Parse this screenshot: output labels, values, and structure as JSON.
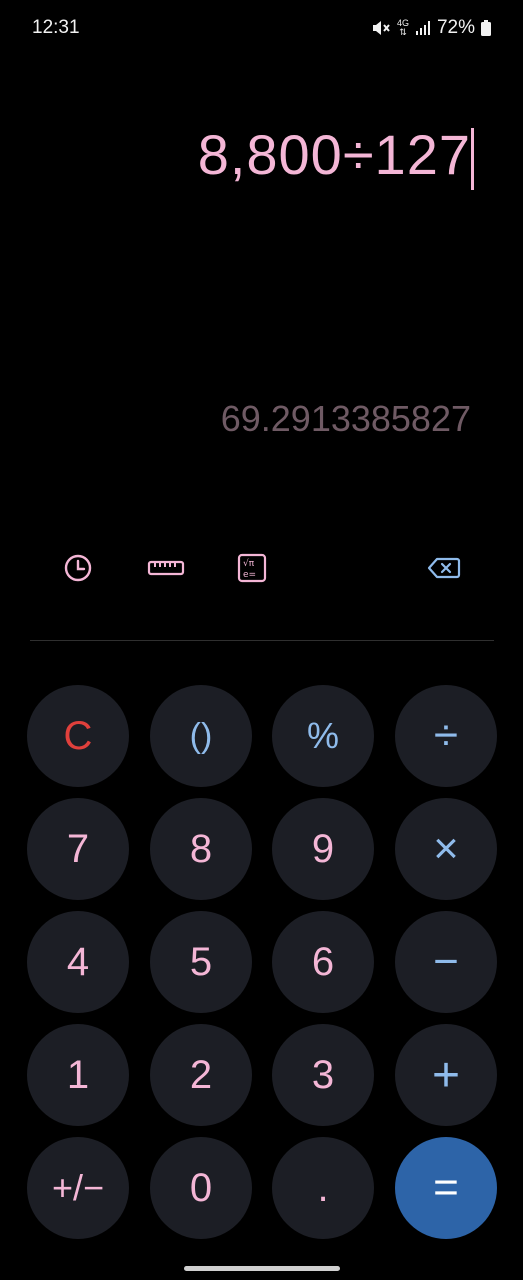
{
  "status_bar": {
    "time": "12:31",
    "network": "4G",
    "battery_percent": "72%",
    "icons": [
      "mute-icon",
      "4g-icon",
      "signal-icon",
      "battery-icon"
    ]
  },
  "display": {
    "expression": "8,800÷127",
    "result": "69.2913385827"
  },
  "toolbar": {
    "icons": [
      "history-icon",
      "unit-converter-icon",
      "scientific-icon",
      "backspace-icon"
    ]
  },
  "keypad": {
    "rows": [
      [
        "C",
        "()",
        "%",
        "÷"
      ],
      [
        "7",
        "8",
        "9",
        "×"
      ],
      [
        "4",
        "5",
        "6",
        "−"
      ],
      [
        "1",
        "2",
        "3",
        "+"
      ],
      [
        "+/−",
        "0",
        ".",
        "="
      ]
    ]
  },
  "colors": {
    "background": "#000000",
    "digit": "#f4b6d6",
    "operator": "#8fbbeb",
    "clear": "#e0403c",
    "key_bg": "#1c1e25",
    "equals_bg": "#2d64a8",
    "result_text": "#6f5a64"
  }
}
